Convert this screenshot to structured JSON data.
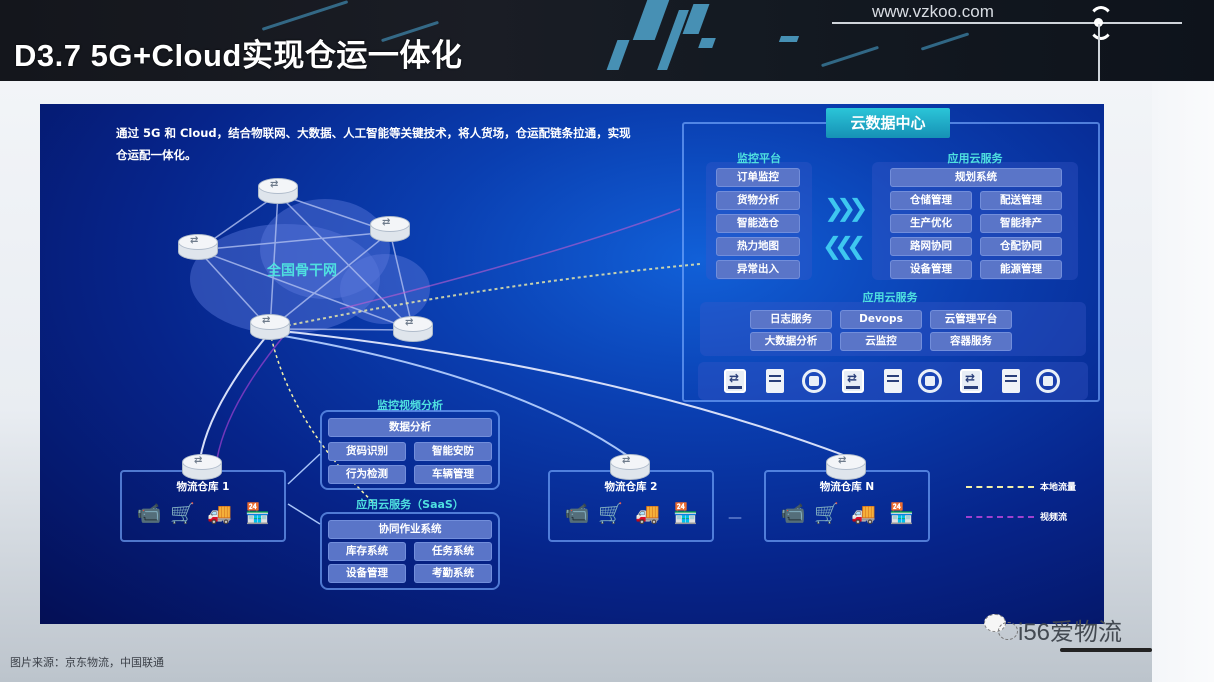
{
  "header": {
    "title": "D3.7  5G+Cloud实现仓运一体化",
    "url": "www.vzkoo.com"
  },
  "diagram": {
    "intro": "通过 5G 和 Cloud，结合物联网、大数据、人工智能等关键技术，将人货场，仓运配链条拉通，实现仓运配一体化。",
    "backbone_label": "全国骨干网",
    "router_glyph": "⇄",
    "data_center": {
      "title": "云数据中心",
      "monitor_platform": {
        "label": "监控平台",
        "items": [
          "订单监控",
          "货物分析",
          "智能选仓",
          "热力地图",
          "异常出入"
        ]
      },
      "arrow_right": "❯❯❯",
      "arrow_left": "❮❮❮",
      "app_cloud_top": {
        "label": "应用云服务",
        "header_item": "规划系统",
        "items": [
          "仓储管理",
          "配送管理",
          "生产优化",
          "智能排产",
          "路网协同",
          "仓配协同",
          "设备管理",
          "能源管理"
        ]
      },
      "app_cloud_bottom": {
        "label": "应用云服务",
        "items": [
          "日志服务",
          "Devops",
          "云管理平台",
          "大数据分析",
          "云监控",
          "容器服务"
        ]
      },
      "equipment": [
        "switch",
        "server",
        "storage",
        "switch",
        "server",
        "storage",
        "switch",
        "server",
        "storage"
      ]
    },
    "video_analysis": {
      "label": "监控视频分析",
      "header_item": "数据分析",
      "items": [
        "货码识别",
        "智能安防",
        "行为检测",
        "车辆管理"
      ]
    },
    "saas": {
      "label": "应用云服务（SaaS）",
      "header_item": "协同作业系统",
      "items": [
        "库存系统",
        "任务系统",
        "设备管理",
        "考勤系统"
      ]
    },
    "warehouses": [
      {
        "label": "物流仓库 1",
        "icons": [
          "camera-icon",
          "cart-icon",
          "truck-icon",
          "store-icon"
        ]
      },
      {
        "label": "物流仓库 2",
        "icons": [
          "camera-icon",
          "cart-icon",
          "truck-icon",
          "store-icon"
        ]
      },
      {
        "label": "物流仓库 N",
        "icons": [
          "camera-icon",
          "cart-icon",
          "truck-icon",
          "store-icon"
        ]
      }
    ],
    "icon_glyphs": {
      "camera": "📹",
      "cart": "🛒",
      "truck": "🚚",
      "store": "🏪"
    },
    "ellipsis": "—",
    "legend": [
      {
        "label": "本地流量",
        "color": "#f3f0a8"
      },
      {
        "label": "视频流",
        "color": "#a040d0"
      }
    ],
    "colors": {
      "accent_cyan": "#4fe0e0",
      "tile_blue": "#5a75c8",
      "panel_blue": "#0a3eb0"
    }
  },
  "footer": {
    "source": "图片来源：京东物流，中国联通",
    "brand": "i56爱物流"
  }
}
